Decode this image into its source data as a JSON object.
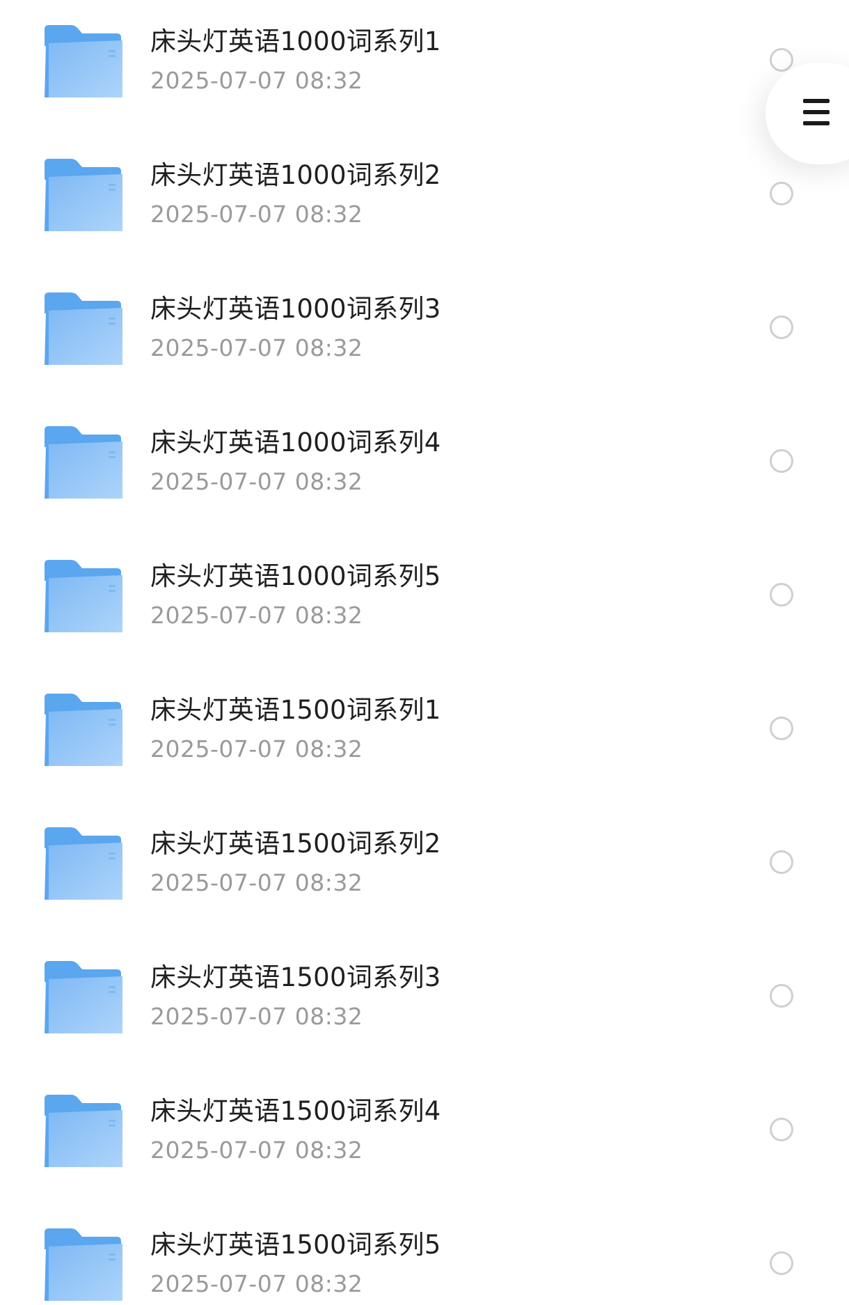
{
  "file_list": {
    "items": [
      {
        "name": "床头灯英语1000词系列1",
        "date": "2025-07-07 08:32"
      },
      {
        "name": "床头灯英语1000词系列2",
        "date": "2025-07-07 08:32"
      },
      {
        "name": "床头灯英语1000词系列3",
        "date": "2025-07-07 08:32"
      },
      {
        "name": "床头灯英语1000词系列4",
        "date": "2025-07-07 08:32"
      },
      {
        "name": "床头灯英语1000词系列5",
        "date": "2025-07-07 08:32"
      },
      {
        "name": "床头灯英语1500词系列1",
        "date": "2025-07-07 08:32"
      },
      {
        "name": "床头灯英语1500词系列2",
        "date": "2025-07-07 08:32"
      },
      {
        "name": "床头灯英语1500词系列3",
        "date": "2025-07-07 08:32"
      },
      {
        "name": "床头灯英语1500词系列4",
        "date": "2025-07-07 08:32"
      },
      {
        "name": "床头灯英语1500词系列5",
        "date": "2025-07-07 08:32"
      }
    ]
  },
  "icons": {
    "folder": "folder-icon",
    "select": "radio-unchecked-icon",
    "menu": "hamburger-menu-icon"
  },
  "colors": {
    "folder_back": "#5aa6ef",
    "folder_front": "#8ec3f6",
    "title_text": "#1f1f1f",
    "date_text": "#9a9a9a",
    "radio_border": "#cfcfcf"
  }
}
